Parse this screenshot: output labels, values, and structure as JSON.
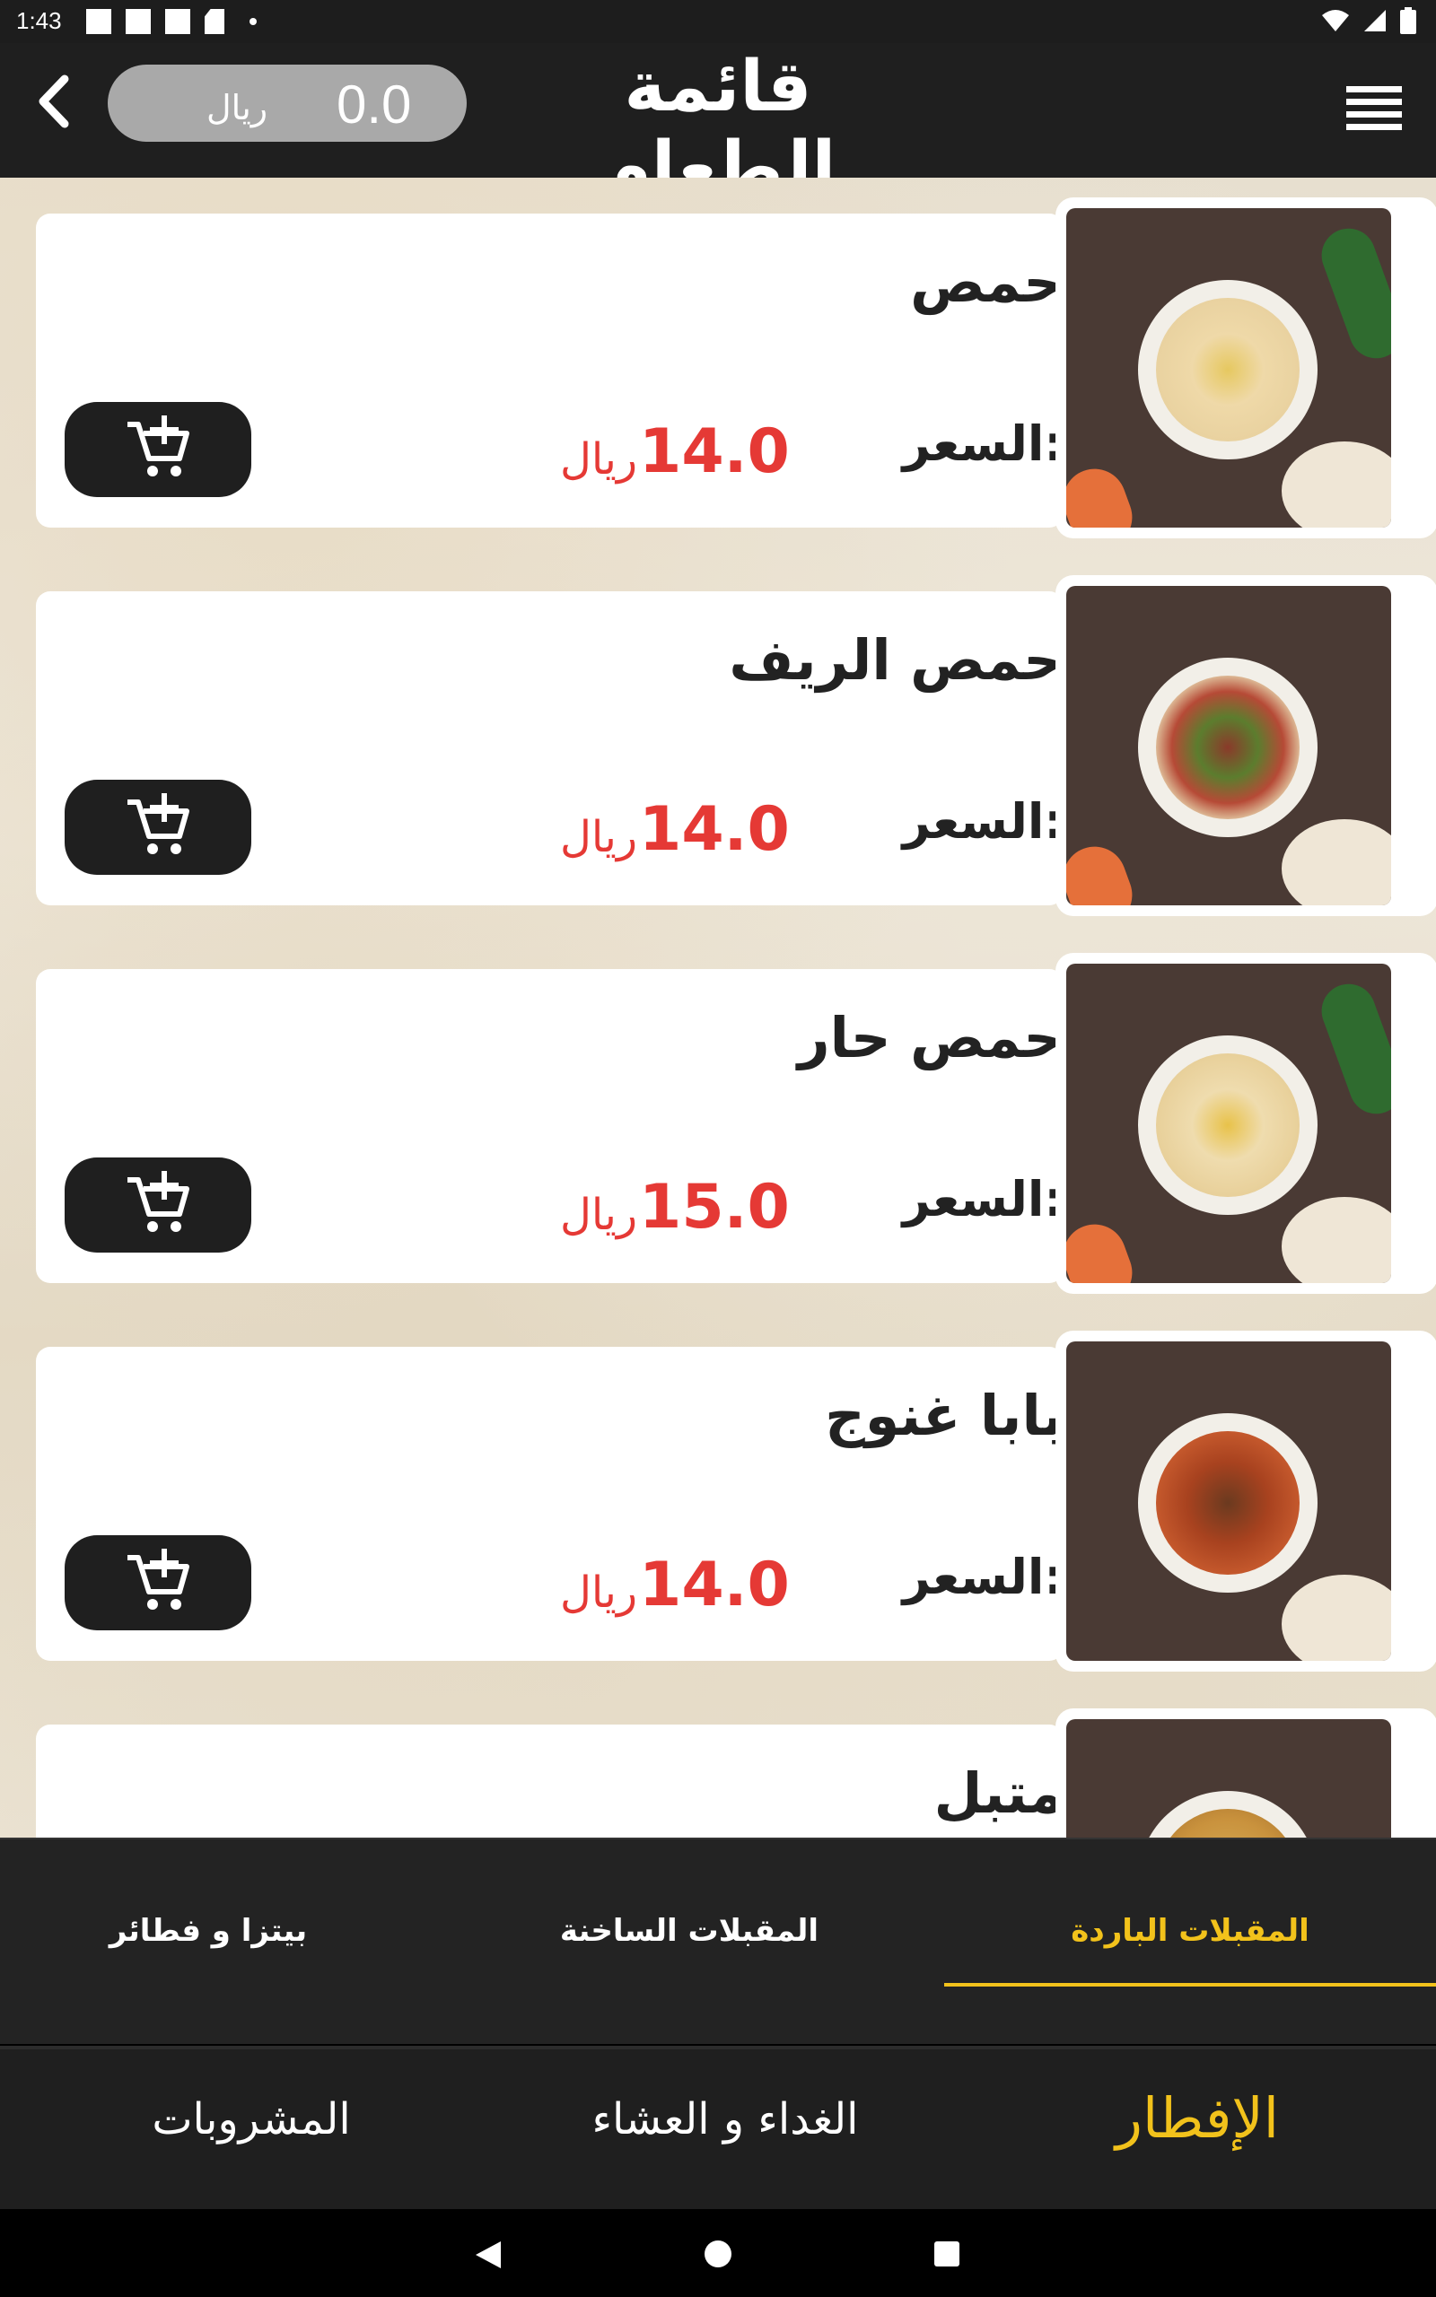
{
  "status": {
    "time": "1:43"
  },
  "header": {
    "title": "قائمة الطعام",
    "cart_total": "0.0",
    "cart_currency": "ريال"
  },
  "items": [
    {
      "name": "حمص",
      "price_label": "السعر:",
      "price": "14.0",
      "currency": "ريال"
    },
    {
      "name": "حمص الريف",
      "price_label": "السعر:",
      "price": "14.0",
      "currency": "ريال"
    },
    {
      "name": "حمص حار",
      "price_label": "السعر:",
      "price": "15.0",
      "currency": "ريال"
    },
    {
      "name": "بابا غنوج",
      "price_label": "السعر:",
      "price": "14.0",
      "currency": "ريال"
    },
    {
      "name": "متبل"
    }
  ],
  "subcategory_tabs": [
    {
      "label": "المقبلات الباردة",
      "active": true
    },
    {
      "label": "المقبلات الساخنة",
      "active": false
    },
    {
      "label": "بيتزا و فطائر",
      "active": false
    }
  ],
  "categories": [
    {
      "label": "الإفطار",
      "active": true
    },
    {
      "label": "الغداء و العشاء",
      "active": false
    },
    {
      "label": "المشروبات",
      "active": false
    }
  ],
  "colors": {
    "accent": "#f2c21b",
    "price": "#e53935",
    "bar": "#1f1f1f"
  }
}
